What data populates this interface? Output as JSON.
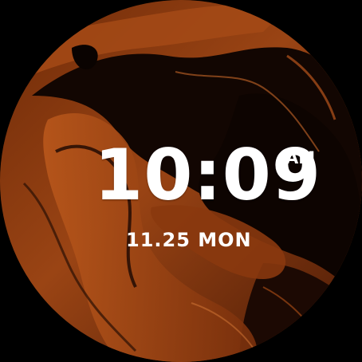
{
  "watch_face": {
    "time": "10:09",
    "ampm": "AM",
    "date": "11.25 MON"
  },
  "colors": {
    "text": "#ffffff",
    "background": "#000000",
    "marble_dark": "#120602",
    "marble_rust": "#8f3d12",
    "marble_amber": "#c8631e"
  }
}
